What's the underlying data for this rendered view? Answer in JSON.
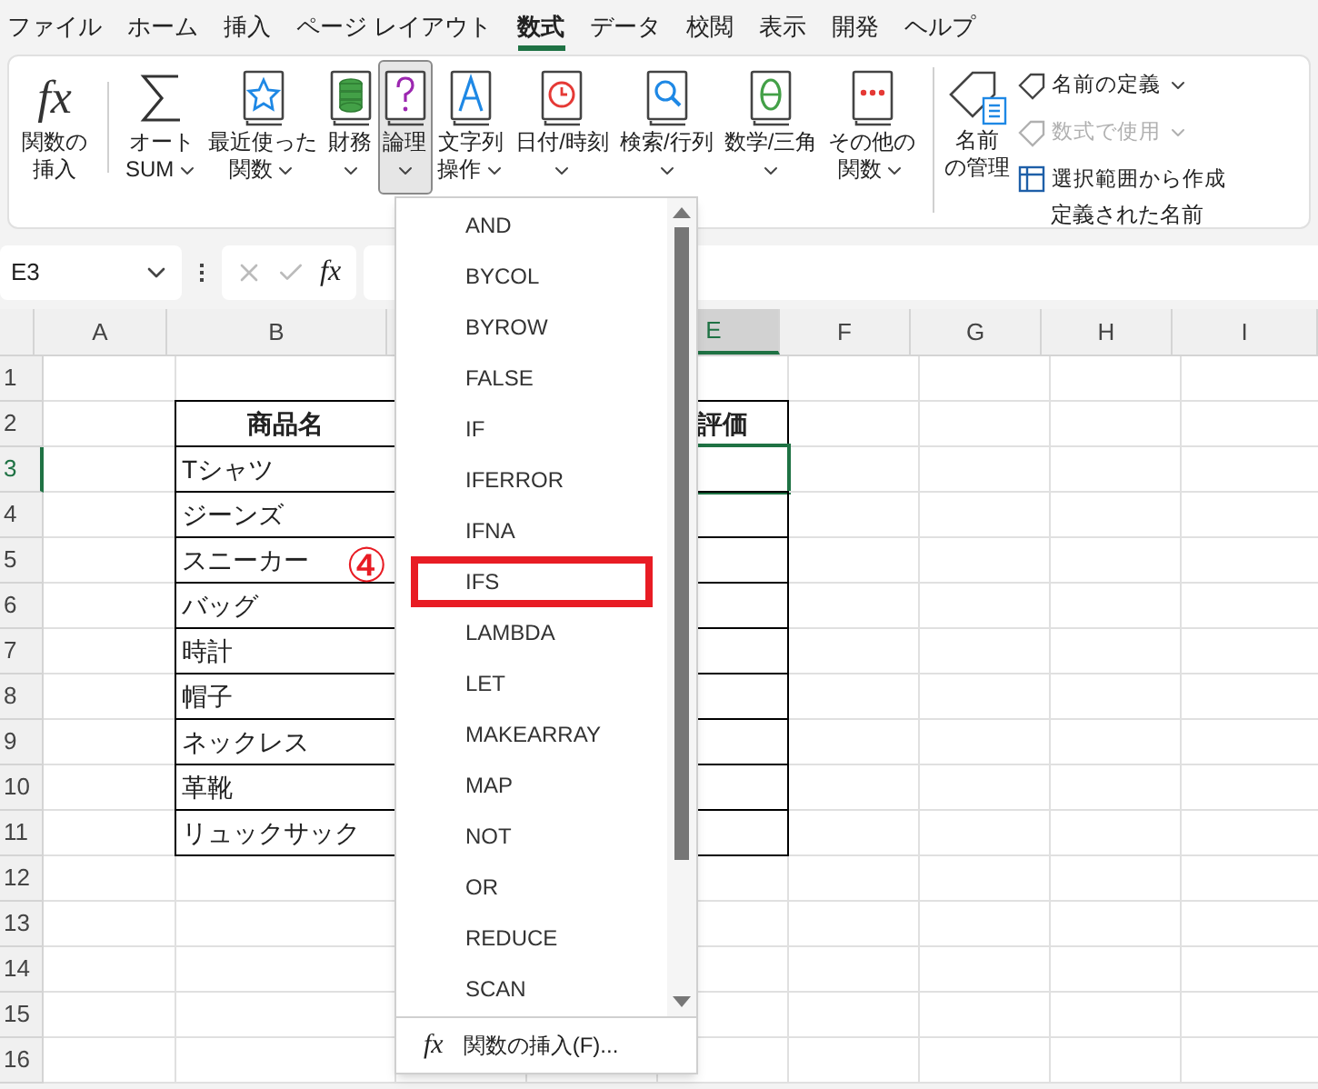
{
  "menu_tabs": [
    {
      "label": "ファイル",
      "selected": false
    },
    {
      "label": "ホーム",
      "selected": false
    },
    {
      "label": "挿入",
      "selected": false
    },
    {
      "label": "ページ レイアウト",
      "selected": false
    },
    {
      "label": "数式",
      "selected": true
    },
    {
      "label": "データ",
      "selected": false
    },
    {
      "label": "校閲",
      "selected": false
    },
    {
      "label": "表示",
      "selected": false
    },
    {
      "label": "開発",
      "selected": false
    },
    {
      "label": "ヘルプ",
      "selected": false
    }
  ],
  "ribbon": {
    "buttons": [
      {
        "symbol": "fx",
        "lines": [
          "関数の",
          "挿入"
        ],
        "dropdown": false,
        "pressed": false
      },
      {
        "lines": [
          "オート",
          "SUM"
        ],
        "dropdown": true,
        "pressed": false
      },
      {
        "lines": [
          "最近使った",
          "関数"
        ],
        "dropdown": true,
        "pressed": false
      },
      {
        "lines": [
          "財務"
        ],
        "dropdown": true,
        "pressed": false
      },
      {
        "lines": [
          "論理"
        ],
        "dropdown": true,
        "pressed": true
      },
      {
        "lines": [
          "文字列",
          "操作"
        ],
        "dropdown": true,
        "pressed": false
      },
      {
        "lines": [
          "日付/時刻"
        ],
        "dropdown": true,
        "pressed": false
      },
      {
        "lines": [
          "検索/行列"
        ],
        "dropdown": true,
        "pressed": false
      },
      {
        "lines": [
          "数学/三角"
        ],
        "dropdown": true,
        "pressed": false
      },
      {
        "lines": [
          "その他の",
          "関数"
        ],
        "dropdown": true,
        "pressed": false
      }
    ],
    "names_group": {
      "manager": {
        "lines": [
          "名前",
          "の管理"
        ]
      },
      "small_buttons": [
        {
          "label": "名前の定義",
          "dropdown": true,
          "disabled": false
        },
        {
          "label": "数式で使用",
          "dropdown": true,
          "disabled": true
        },
        {
          "label": "選択範囲から作成",
          "dropdown": false,
          "disabled": false
        }
      ],
      "group_label": "定義された名前"
    }
  },
  "formula_bar": {
    "name_box": "E3",
    "symbol": "fx"
  },
  "sheet": {
    "columns": [
      {
        "label": "A",
        "selected": false
      },
      {
        "label": "B",
        "selected": false
      },
      {},
      {},
      {
        "label": "E",
        "selected": true
      },
      {
        "label": "F",
        "selected": false
      },
      {
        "label": "G",
        "selected": false
      },
      {
        "label": "H",
        "selected": false
      },
      {
        "label": "I",
        "selected": false
      }
    ],
    "rows": [
      {
        "label": "1",
        "selected": false,
        "kind": "empty"
      },
      {
        "label": "2",
        "selected": false,
        "kind": "header",
        "B": "商品名",
        "E": "評価"
      },
      {
        "label": "3",
        "selected": true,
        "kind": "data",
        "B": "Tシャツ"
      },
      {
        "label": "4",
        "selected": false,
        "kind": "data",
        "B": "ジーンズ"
      },
      {
        "label": "5",
        "selected": false,
        "kind": "data",
        "B": "スニーカー"
      },
      {
        "label": "6",
        "selected": false,
        "kind": "data",
        "B": "バッグ"
      },
      {
        "label": "7",
        "selected": false,
        "kind": "data",
        "B": "時計"
      },
      {
        "label": "8",
        "selected": false,
        "kind": "data",
        "B": "帽子"
      },
      {
        "label": "9",
        "selected": false,
        "kind": "data",
        "B": "ネックレス"
      },
      {
        "label": "10",
        "selected": false,
        "kind": "data",
        "B": "革靴"
      },
      {
        "label": "11",
        "selected": false,
        "kind": "data",
        "B": "リュックサック"
      },
      {
        "label": "12",
        "selected": false,
        "kind": "empty"
      },
      {
        "label": "13",
        "selected": false,
        "kind": "empty"
      },
      {
        "label": "14",
        "selected": false,
        "kind": "empty"
      },
      {
        "label": "15",
        "selected": false,
        "kind": "empty"
      },
      {
        "label": "16",
        "selected": false,
        "kind": "empty"
      }
    ]
  },
  "annotation": "④",
  "dropdown": {
    "items": [
      {
        "label": "AND",
        "highlighted": false
      },
      {
        "label": "BYCOL",
        "highlighted": false
      },
      {
        "label": "BYROW",
        "highlighted": false
      },
      {
        "label": "FALSE",
        "highlighted": false
      },
      {
        "label": "IF",
        "highlighted": false
      },
      {
        "label": "IFERROR",
        "highlighted": false
      },
      {
        "label": "IFNA",
        "highlighted": false
      },
      {
        "label": "IFS",
        "highlighted": true
      },
      {
        "label": "LAMBDA",
        "highlighted": false
      },
      {
        "label": "LET",
        "highlighted": false
      },
      {
        "label": "MAKEARRAY",
        "highlighted": false
      },
      {
        "label": "MAP",
        "highlighted": false
      },
      {
        "label": "NOT",
        "highlighted": false
      },
      {
        "label": "OR",
        "highlighted": false
      },
      {
        "label": "REDUCE",
        "highlighted": false
      },
      {
        "label": "SCAN",
        "highlighted": false
      }
    ],
    "footer_symbol": "fx",
    "footer": "関数の挿入(F)..."
  }
}
